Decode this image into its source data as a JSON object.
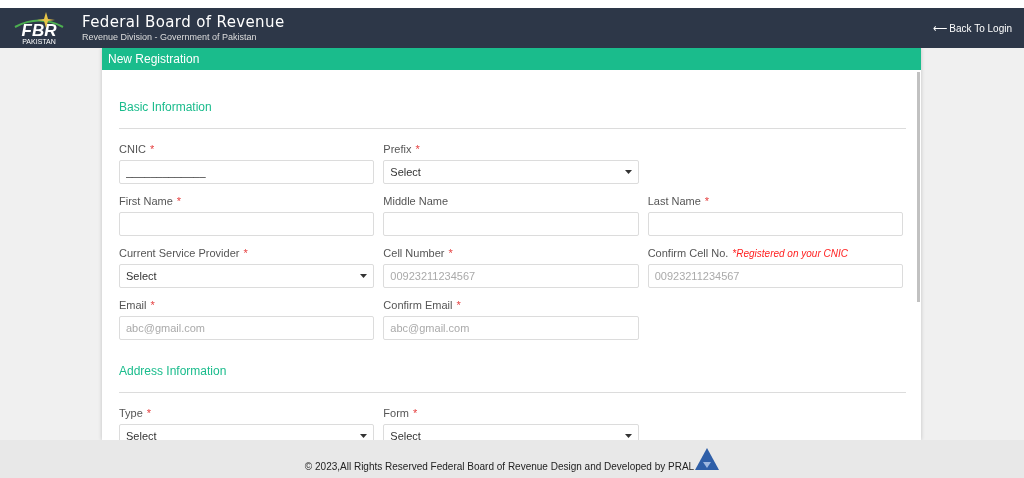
{
  "header": {
    "logo_text": "FBR",
    "logo_subtext": "PAKISTAN",
    "title": "Federal Board of Revenue",
    "subtitle": "Revenue Division - Government of Pakistan",
    "back_link": "⟵ Back To Login"
  },
  "card": {
    "title": "New Registration",
    "sections": [
      {
        "title": "Basic Information",
        "rows": [
          [
            {
              "kind": "text",
              "label": "CNIC",
              "asterisk": "*",
              "value": "_____________"
            },
            {
              "kind": "select",
              "label": "Prefix",
              "asterisk": "*",
              "value": "Select"
            }
          ],
          [
            {
              "kind": "text",
              "label": "First Name",
              "asterisk": "*"
            },
            {
              "kind": "text",
              "label": "Middle Name"
            },
            {
              "kind": "text",
              "label": "Last Name",
              "asterisk": "*"
            }
          ],
          [
            {
              "kind": "select",
              "label": "Current Service Provider",
              "asterisk": "*",
              "value": "Select"
            },
            {
              "kind": "text",
              "label": "Cell Number",
              "asterisk": "*",
              "placeholder": "00923211234567"
            },
            {
              "kind": "text",
              "label": "Confirm Cell No.",
              "note": "*Registered on your CNIC",
              "placeholder": "00923211234567"
            }
          ],
          [
            {
              "kind": "text",
              "label": "Email",
              "asterisk": "*",
              "placeholder": "abc@gmail.com"
            },
            {
              "kind": "text",
              "label": "Confirm Email",
              "asterisk": "*",
              "placeholder": "abc@gmail.com"
            }
          ]
        ]
      },
      {
        "title": "Address Information",
        "rows": [
          [
            {
              "kind": "select",
              "label": "Type",
              "asterisk": "*",
              "value": "Select"
            },
            {
              "kind": "select",
              "label": "Form",
              "asterisk": "*",
              "value": "Select"
            }
          ]
        ]
      }
    ]
  },
  "footer": {
    "text": "© 2023,All Rights Reserved Federal Board of Revenue Design and Developed by PRAL"
  }
}
